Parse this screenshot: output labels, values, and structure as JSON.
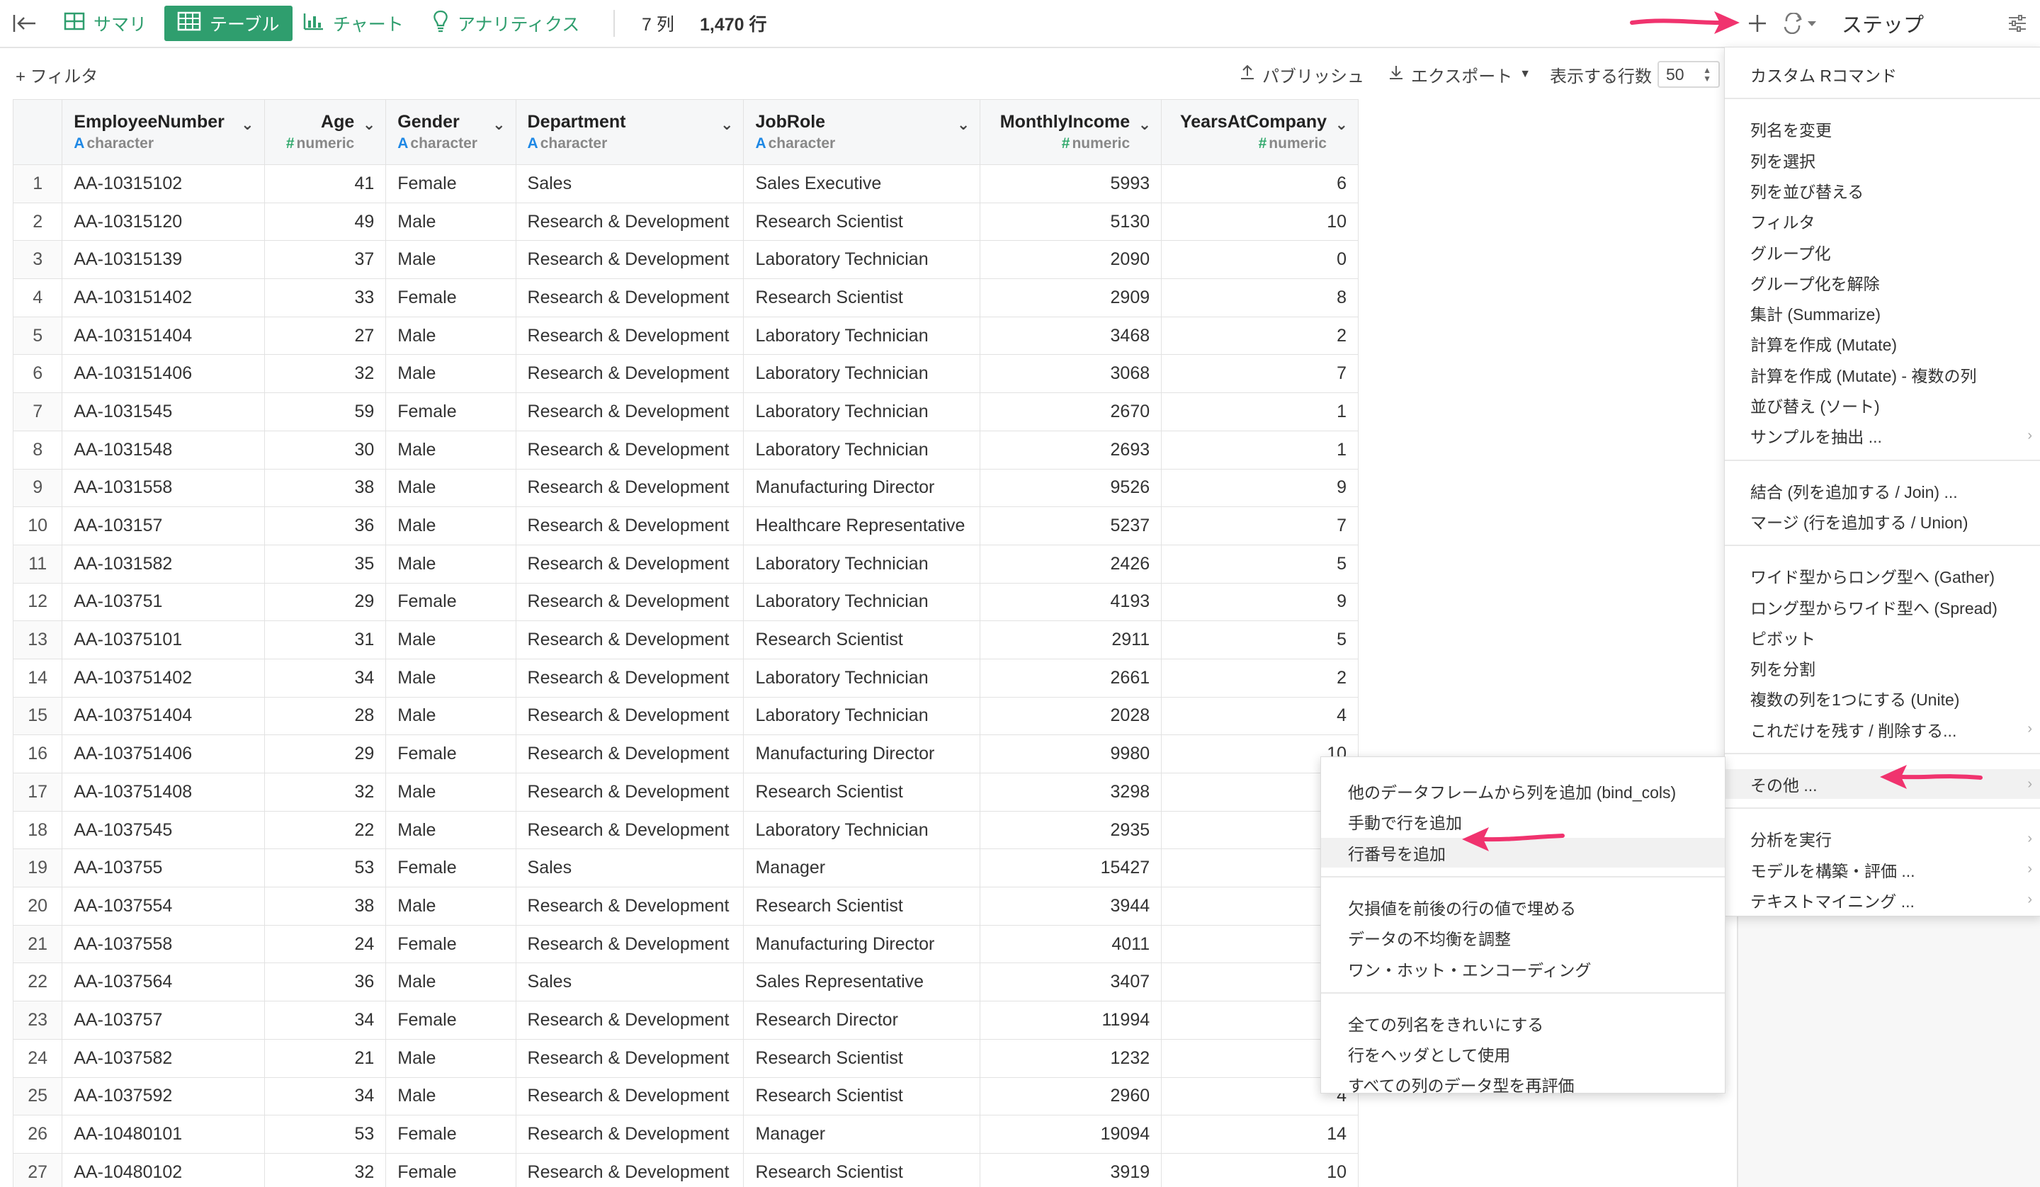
{
  "toolbar": {
    "tabs": [
      {
        "label": "サマリ",
        "icon": "grid-icon"
      },
      {
        "label": "テーブル",
        "icon": "table-icon"
      },
      {
        "label": "チャート",
        "icon": "chart-icon"
      },
      {
        "label": "アナリティクス",
        "icon": "bulb-icon"
      }
    ],
    "columns_count": "7 列",
    "rows_count": "1,470 行",
    "steps_title": "ステップ"
  },
  "subbar": {
    "filter_label": "+ フィルタ",
    "publish_label": "パブリッシュ",
    "export_label": "エクスポート",
    "rows_label": "表示する行数",
    "rows_value": "50"
  },
  "table": {
    "columns": [
      {
        "name": "EmployeeNumber",
        "type": "character",
        "num": false
      },
      {
        "name": "Age",
        "type": "numeric",
        "num": true
      },
      {
        "name": "Gender",
        "type": "character",
        "num": false
      },
      {
        "name": "Department",
        "type": "character",
        "num": false
      },
      {
        "name": "JobRole",
        "type": "character",
        "num": false
      },
      {
        "name": "MonthlyIncome",
        "type": "numeric",
        "num": true
      },
      {
        "name": "YearsAtCompany",
        "type": "numeric",
        "num": true
      }
    ],
    "rows": [
      [
        "1",
        "AA-10315102",
        "41",
        "Female",
        "Sales",
        "Sales Executive",
        "5993",
        "6"
      ],
      [
        "2",
        "AA-10315120",
        "49",
        "Male",
        "Research & Development",
        "Research Scientist",
        "5130",
        "10"
      ],
      [
        "3",
        "AA-10315139",
        "37",
        "Male",
        "Research & Development",
        "Laboratory Technician",
        "2090",
        "0"
      ],
      [
        "4",
        "AA-103151402",
        "33",
        "Female",
        "Research & Development",
        "Research Scientist",
        "2909",
        "8"
      ],
      [
        "5",
        "AA-103151404",
        "27",
        "Male",
        "Research & Development",
        "Laboratory Technician",
        "3468",
        "2"
      ],
      [
        "6",
        "AA-103151406",
        "32",
        "Male",
        "Research & Development",
        "Laboratory Technician",
        "3068",
        "7"
      ],
      [
        "7",
        "AA-1031545",
        "59",
        "Female",
        "Research & Development",
        "Laboratory Technician",
        "2670",
        "1"
      ],
      [
        "8",
        "AA-1031548",
        "30",
        "Male",
        "Research & Development",
        "Laboratory Technician",
        "2693",
        "1"
      ],
      [
        "9",
        "AA-1031558",
        "38",
        "Male",
        "Research & Development",
        "Manufacturing Director",
        "9526",
        "9"
      ],
      [
        "10",
        "AA-103157",
        "36",
        "Male",
        "Research & Development",
        "Healthcare Representative",
        "5237",
        "7"
      ],
      [
        "11",
        "AA-1031582",
        "35",
        "Male",
        "Research & Development",
        "Laboratory Technician",
        "2426",
        "5"
      ],
      [
        "12",
        "AA-103751",
        "29",
        "Female",
        "Research & Development",
        "Laboratory Technician",
        "4193",
        "9"
      ],
      [
        "13",
        "AA-10375101",
        "31",
        "Male",
        "Research & Development",
        "Research Scientist",
        "2911",
        "5"
      ],
      [
        "14",
        "AA-103751402",
        "34",
        "Male",
        "Research & Development",
        "Laboratory Technician",
        "2661",
        "2"
      ],
      [
        "15",
        "AA-103751404",
        "28",
        "Male",
        "Research & Development",
        "Laboratory Technician",
        "2028",
        "4"
      ],
      [
        "16",
        "AA-103751406",
        "29",
        "Female",
        "Research & Development",
        "Manufacturing Director",
        "9980",
        "10"
      ],
      [
        "17",
        "AA-103751408",
        "32",
        "Male",
        "Research & Development",
        "Research Scientist",
        "3298",
        ""
      ],
      [
        "18",
        "AA-1037545",
        "22",
        "Male",
        "Research & Development",
        "Laboratory Technician",
        "2935",
        ""
      ],
      [
        "19",
        "AA-103755",
        "53",
        "Female",
        "Sales",
        "Manager",
        "15427",
        ""
      ],
      [
        "20",
        "AA-1037554",
        "38",
        "Male",
        "Research & Development",
        "Research Scientist",
        "3944",
        ""
      ],
      [
        "21",
        "AA-1037558",
        "24",
        "Female",
        "Research & Development",
        "Manufacturing Director",
        "4011",
        ""
      ],
      [
        "22",
        "AA-1037564",
        "36",
        "Male",
        "Sales",
        "Sales Representative",
        "3407",
        ""
      ],
      [
        "23",
        "AA-103757",
        "34",
        "Female",
        "Research & Development",
        "Research Director",
        "11994",
        ""
      ],
      [
        "24",
        "AA-1037582",
        "21",
        "Male",
        "Research & Development",
        "Research Scientist",
        "1232",
        ""
      ],
      [
        "25",
        "AA-1037592",
        "34",
        "Male",
        "Research & Development",
        "Research Scientist",
        "2960",
        "4"
      ],
      [
        "26",
        "AA-10480101",
        "53",
        "Female",
        "Research & Development",
        "Manager",
        "19094",
        "14"
      ],
      [
        "27",
        "AA-10480102",
        "32",
        "Female",
        "Research & Development",
        "Research Scientist",
        "3919",
        "10"
      ]
    ]
  },
  "step_menu": {
    "items": [
      {
        "label": "カスタム Rコマンド",
        "arrow": false,
        "sep_after": true
      },
      {
        "label": "列名を変更",
        "arrow": false
      },
      {
        "label": "列を選択",
        "arrow": false
      },
      {
        "label": "列を並び替える",
        "arrow": false
      },
      {
        "label": "フィルタ",
        "arrow": false
      },
      {
        "label": "グループ化",
        "arrow": false
      },
      {
        "label": "グループ化を解除",
        "arrow": false
      },
      {
        "label": "集計 (Summarize)",
        "arrow": false
      },
      {
        "label": "計算を作成 (Mutate)",
        "arrow": false
      },
      {
        "label": "計算を作成 (Mutate) - 複数の列",
        "arrow": false
      },
      {
        "label": "並び替え (ソート)",
        "arrow": false
      },
      {
        "label": "サンプルを抽出 ...",
        "arrow": true,
        "sep_after": true
      },
      {
        "label": "結合 (列を追加する / Join) ...",
        "arrow": false
      },
      {
        "label": "マージ (行を追加する / Union)",
        "arrow": false,
        "sep_after": true
      },
      {
        "label": "ワイド型からロング型へ (Gather)",
        "arrow": false
      },
      {
        "label": "ロング型からワイド型へ (Spread)",
        "arrow": false
      },
      {
        "label": "ピボット",
        "arrow": false
      },
      {
        "label": "列を分割",
        "arrow": false
      },
      {
        "label": "複数の列を1つにする (Unite)",
        "arrow": false
      },
      {
        "label": "これだけを残す / 削除する...",
        "arrow": true,
        "sep_after": true
      },
      {
        "label": "その他 ...",
        "arrow": true,
        "highlight": true,
        "sep_after": true
      },
      {
        "label": "分析を実行",
        "arrow": true
      },
      {
        "label": "モデルを構築・評価 ...",
        "arrow": true
      },
      {
        "label": "テキストマイニング ...",
        "arrow": true
      }
    ]
  },
  "sub_menu": {
    "items": [
      {
        "label": "他のデータフレームから列を追加 (bind_cols)"
      },
      {
        "label": "手動で行を追加"
      },
      {
        "label": "行番号を追加",
        "highlight": true,
        "sep_after": true
      },
      {
        "label": "欠損値を前後の行の値で埋める"
      },
      {
        "label": "データの不均衡を調整"
      },
      {
        "label": "ワン・ホット・エンコーディング",
        "sep_after": true
      },
      {
        "label": "全ての列名をきれいにする"
      },
      {
        "label": "行をヘッダとして使用"
      },
      {
        "label": "すべての列のデータ型を再評価"
      }
    ]
  },
  "colors": {
    "accent": "#2f9e6e",
    "arrow": "#f0336e",
    "type_char": "#1e88e5",
    "type_num": "#2fa86b"
  }
}
